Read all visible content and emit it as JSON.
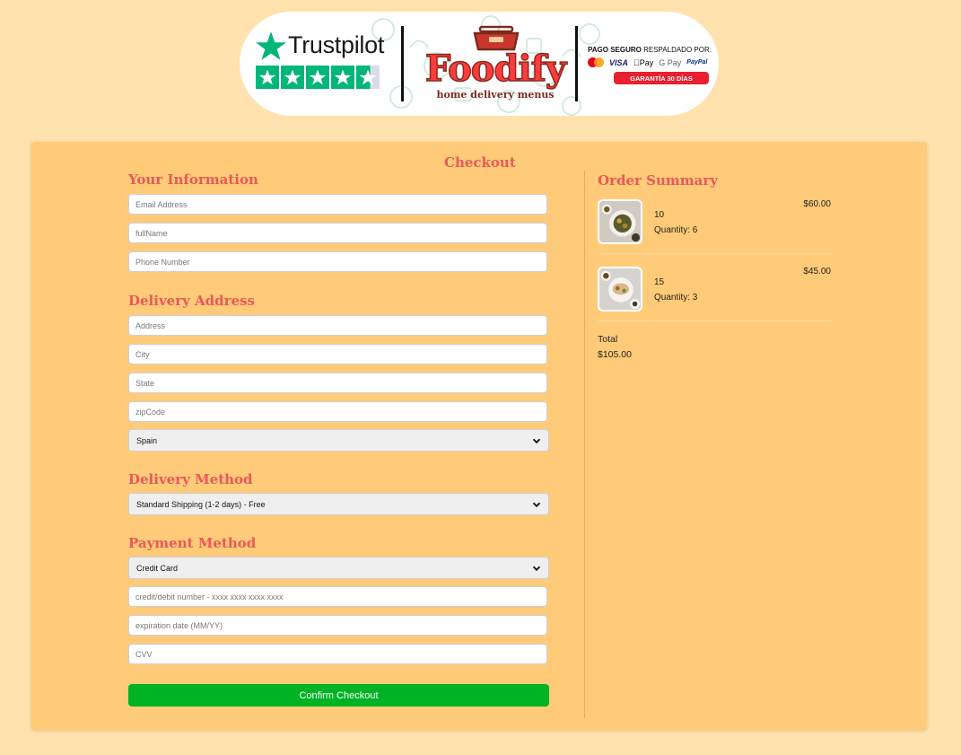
{
  "header": {
    "trustpilot_label": "Trustpilot",
    "brand_name": "Foodify",
    "brand_tagline": "home delivery menus",
    "payment_title_bold": "PAGO SEGURO",
    "payment_title_rest": "RESPALDADO POR:",
    "payment_methods": [
      "VISA",
      "Pay",
      "G Pay",
      "PayPal"
    ],
    "guarantee": "GARANTÍA 30 DÍAS",
    "trustpilot_rating": 4.5,
    "accent_color": "#00b67a"
  },
  "checkout": {
    "title": "Checkout",
    "your_info": {
      "title": "Your Information",
      "email_placeholder": "Email Address",
      "fullname_placeholder": "fullName",
      "phone_placeholder": "Phone Number"
    },
    "delivery_address": {
      "title": "Delivery Address",
      "address_placeholder": "Address",
      "city_placeholder": "City",
      "state_placeholder": "State",
      "zip_placeholder": "zipCode",
      "country_selected": "Spain"
    },
    "delivery_method": {
      "title": "Delivery Method",
      "selected": "Standard Shipping (1-2 days) - Free"
    },
    "payment_method": {
      "title": "Payment Method",
      "selected": "Credit Card",
      "card_placeholder": "credit/debit number - xxxx xxxx xxxx xxxx",
      "expiry_placeholder": "expiration date (MM/YY)",
      "cvv_placeholder": "CVV"
    },
    "confirm_label": "Confirm Checkout",
    "confirm_color": "#00b324"
  },
  "summary": {
    "title": "Order Summary",
    "items": [
      {
        "name": "10",
        "quantity": "Quantity: 6",
        "price": "$60.00"
      },
      {
        "name": "15",
        "quantity": "Quantity: 3",
        "price": "$45.00"
      }
    ],
    "total_label": "Total",
    "total_value": "$105.00"
  }
}
